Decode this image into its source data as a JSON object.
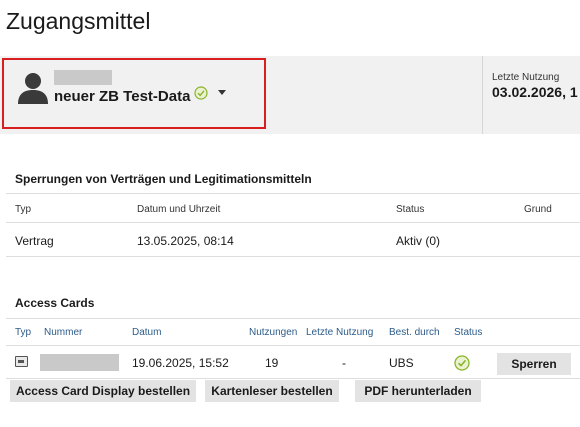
{
  "page": {
    "title": "Zugangsmittel"
  },
  "user": {
    "name": "neuer ZB Test-Data"
  },
  "last_use": {
    "label": "Letzte Nutzung",
    "value": "03.02.2026, 1"
  },
  "blocks": {
    "title": "Sperrungen von Verträgen und Legitimationsmitteln",
    "headers": {
      "typ": "Typ",
      "datum": "Datum und Uhrzeit",
      "status": "Status",
      "grund": "Grund"
    },
    "rows": [
      {
        "typ": "Vertrag",
        "datum": "13.05.2025, 08:14",
        "status": "Aktiv (0)",
        "grund": ""
      }
    ]
  },
  "cards": {
    "title": "Access Cards",
    "headers": {
      "typ": "Typ",
      "nummer": "Nummer",
      "datum": "Datum",
      "nutzungen": "Nutzungen",
      "letzte": "Letzte Nutzung",
      "bestellt": "Best. durch",
      "status": "Status"
    },
    "rows": [
      {
        "datum": "19.06.2025, 15:52",
        "nutzungen": "19",
        "letzte": "-",
        "bestellt": "UBS",
        "action": "Sperren"
      }
    ]
  },
  "buttons": {
    "display": "Access Card Display bestellen",
    "reader": "Kartenleser bestellen",
    "pdf": "PDF herunterladen"
  },
  "colors": {
    "highlight": "#d81e1e",
    "status_ok": "#8ab42a",
    "header_bg": "#f1f1f1",
    "link": "#2c5c8a"
  }
}
